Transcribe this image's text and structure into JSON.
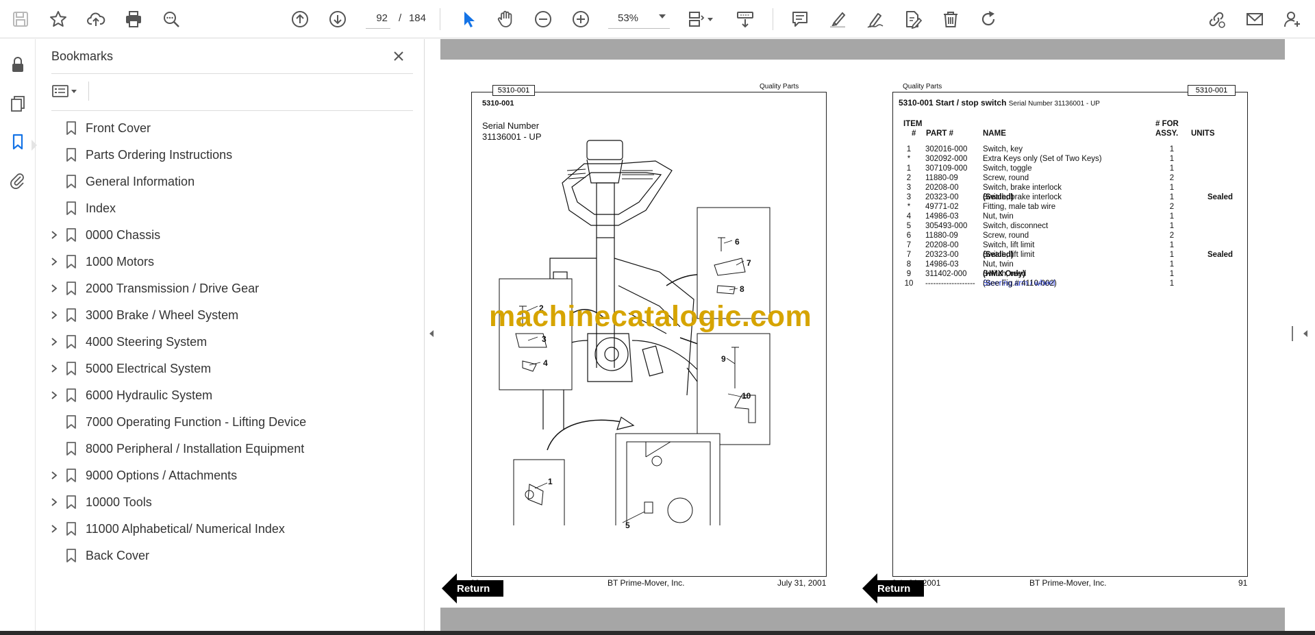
{
  "toolbar": {
    "page_current": "92",
    "page_separator": "/",
    "page_total": "184",
    "zoom": "53%"
  },
  "bookmarks": {
    "title": "Bookmarks",
    "items": [
      {
        "label": "Front Cover",
        "expandable": false
      },
      {
        "label": "Parts Ordering Instructions",
        "expandable": false
      },
      {
        "label": "General Information",
        "expandable": false
      },
      {
        "label": "Index",
        "expandable": false
      },
      {
        "label": "0000 Chassis",
        "expandable": true
      },
      {
        "label": "1000 Motors",
        "expandable": true
      },
      {
        "label": "2000 Transmission / Drive Gear",
        "expandable": true
      },
      {
        "label": "3000 Brake / Wheel System",
        "expandable": true
      },
      {
        "label": "4000 Steering System",
        "expandable": true
      },
      {
        "label": "5000 Electrical System",
        "expandable": true
      },
      {
        "label": "6000 Hydraulic System",
        "expandable": true
      },
      {
        "label": "7000 Operating Function - Lifting Device",
        "expandable": false
      },
      {
        "label": "8000 Peripheral / Installation Equipment",
        "expandable": false
      },
      {
        "label": "9000 Options / Attachments",
        "expandable": true
      },
      {
        "label": "10000 Tools",
        "expandable": true
      },
      {
        "label": "11000 Alphabetical/ Numerical Index",
        "expandable": true
      },
      {
        "label": "Back Cover",
        "expandable": false
      }
    ]
  },
  "left_page": {
    "header_code": "5310-001",
    "header_right": "Quality Parts",
    "section_code": "5310-001",
    "serial_label": "Serial Number",
    "serial_value": "31136001 - UP",
    "callouts": [
      "1",
      "2",
      "3",
      "4",
      "5",
      "6",
      "7",
      "8",
      "9",
      "10"
    ],
    "footer_left": "90",
    "footer_center": "BT Prime-Mover, Inc.",
    "footer_right": "July 31, 2001",
    "return_label": "Return"
  },
  "right_page": {
    "header_left": "Quality Parts",
    "header_code": "5310-001",
    "title": "5310-001 Start / stop switch",
    "title_serial": "Serial Number 31136001 - UP",
    "columns": {
      "item_top": "ITEM",
      "item": "#",
      "part": "PART #",
      "name": "NAME",
      "qty_top": "# FOR",
      "qty": "ASSY.",
      "units": "UNITS"
    },
    "rows": [
      {
        "item": "1",
        "part": "302016-000",
        "name": "Switch, key",
        "name_bold": "",
        "qty": "1",
        "units": ""
      },
      {
        "item": "*",
        "part": "302092-000",
        "name": "Extra Keys only (Set of Two Keys)",
        "name_bold": "",
        "qty": "1",
        "units": ""
      },
      {
        "item": "1",
        "part": "307109-000",
        "name": "Switch, toggle",
        "name_bold": "",
        "qty": "1",
        "units": ""
      },
      {
        "item": "2",
        "part": "11880-09",
        "name": "Screw, round",
        "name_bold": "",
        "qty": "2",
        "units": ""
      },
      {
        "item": "3",
        "part": "20208-00",
        "name": "Switch, brake interlock",
        "name_bold": "",
        "qty": "1",
        "units": ""
      },
      {
        "item": "3",
        "part": "20323-00",
        "name": "Switch, brake interlock ",
        "name_bold": "(Sealed)",
        "qty": "1",
        "units": "Sealed"
      },
      {
        "item": "*",
        "part": "49771-02",
        "name": "Fitting, male tab wire",
        "name_bold": "",
        "qty": "2",
        "units": ""
      },
      {
        "item": "4",
        "part": "14986-03",
        "name": "Nut, twin",
        "name_bold": "",
        "qty": "1",
        "units": ""
      },
      {
        "item": "5",
        "part": "305493-000",
        "name": "Switch, disconnect",
        "name_bold": "",
        "qty": "1",
        "units": ""
      },
      {
        "item": "6",
        "part": "11880-09",
        "name": "Screw, round",
        "name_bold": "",
        "qty": "2",
        "units": ""
      },
      {
        "item": "7",
        "part": "20208-00",
        "name": "Switch, lift limit",
        "name_bold": "",
        "qty": "1",
        "units": ""
      },
      {
        "item": "7",
        "part": "20323-00",
        "name": "Switch, lift limit ",
        "name_bold": "(Sealed)",
        "qty": "1",
        "units": "Sealed"
      },
      {
        "item": "8",
        "part": "14986-03",
        "name": "Nut, twin",
        "name_bold": "",
        "qty": "1",
        "units": ""
      },
      {
        "item": "9",
        "part": "311402-000",
        "name": "Switch, reed ",
        "name_bold": "(HMX Only)",
        "qty": "1",
        "units": ""
      }
    ],
    "last_row": {
      "item": "10",
      "part": "-------------------",
      "link": "Steering arm / wheel",
      "name_rest": " (See Fig.# 4110-002)",
      "qty": "1"
    },
    "footer_left": "July 31, 2001",
    "footer_center": "BT Prime-Mover, Inc.",
    "footer_right": "91",
    "return_label": "Return"
  },
  "watermark": "machinecatalogic.com",
  "colors": {
    "accent_blue": "#1473e6",
    "link_blue": "#1a2fd6",
    "watermark_gold": "#d6a400",
    "gray_band": "#a6a6a6"
  }
}
